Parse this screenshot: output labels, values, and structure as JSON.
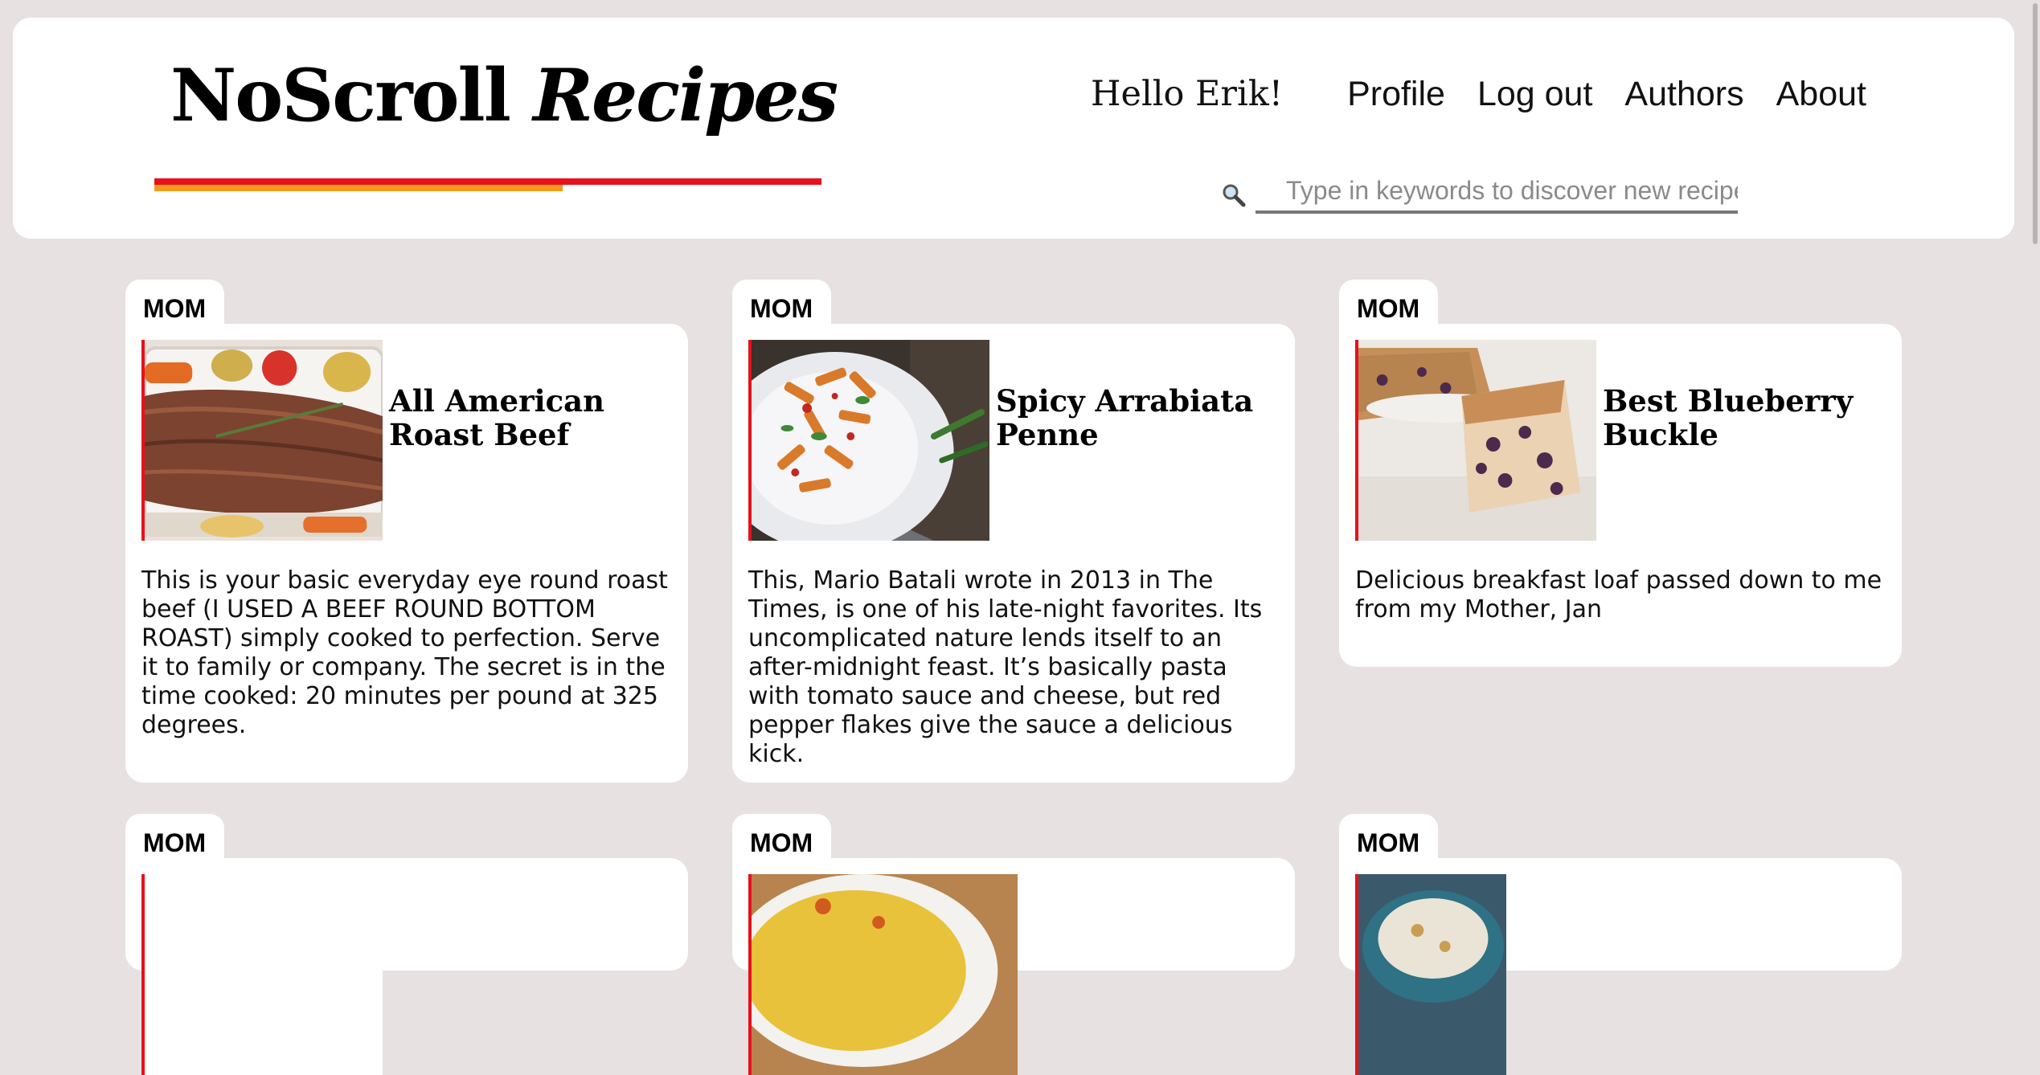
{
  "header": {
    "logo_part1": "NoScroll ",
    "logo_part2": "Recipes",
    "greeting": "Hello Erik!",
    "nav": [
      "Profile",
      "Log out",
      "Authors",
      "About"
    ],
    "search_placeholder": "Type in keywords to discover new recipes",
    "colors": {
      "accent_red": "#e8101c",
      "accent_orange": "#f39a1c"
    }
  },
  "recipes": [
    {
      "tag": "MOM",
      "title": "All American Roast Beef",
      "description": "This is your basic everyday eye round roast beef (I USED A BEEF ROUND BOTTOM ROAST) simply cooked to perfection. Serve it to family or company. The secret is in the time cooked: 20 minutes per pound at 325 degrees.",
      "image": "roast-beef-photo"
    },
    {
      "tag": "MOM",
      "title": "Spicy Arrabiata Penne",
      "description": "This, Mario Batali wrote in 2013 in The Times, is one of his late-night favorites. Its uncomplicated nature lends itself to an after-midnight feast. It’s basically pasta with tomato sauce and cheese, but red pepper flakes give the sauce a delicious kick.",
      "image": "penne-pasta-photo"
    },
    {
      "tag": "MOM",
      "title": "Best Blueberry Buckle",
      "description": "Delicious breakfast loaf passed down to me from my Mother, Jan",
      "image": "blueberry-buckle-photo"
    },
    {
      "tag": "MOM",
      "image": "partial-photo"
    },
    {
      "tag": "MOM",
      "image": "rice-dish-photo"
    },
    {
      "tag": "MOM",
      "image": "bowl-dish-photo"
    }
  ]
}
